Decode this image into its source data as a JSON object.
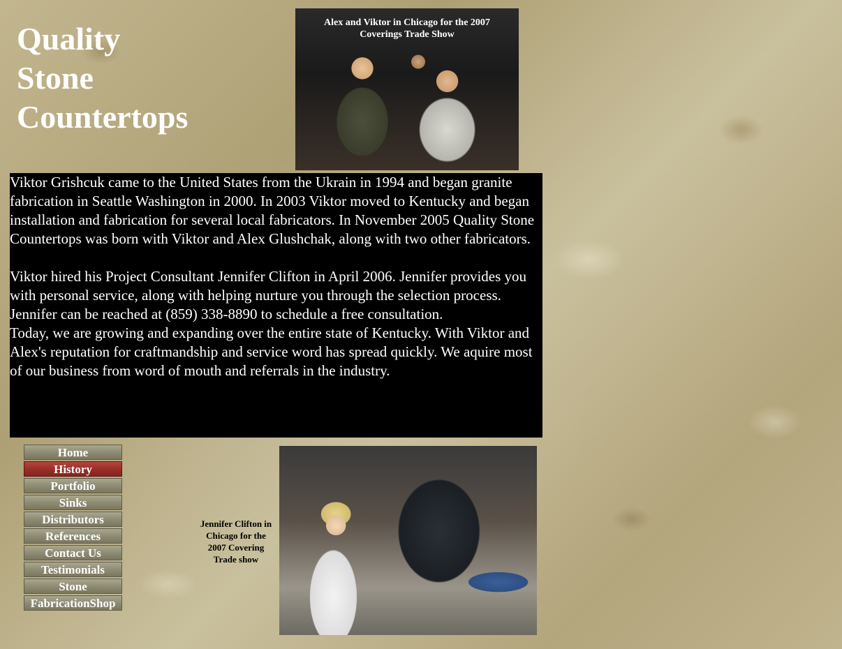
{
  "site": {
    "title_lines": [
      "Quality",
      "Stone",
      "Countertops"
    ]
  },
  "photo_top": {
    "caption_line1": "Alex and Viktor in Chicago for the 2007",
    "caption_line2": "Coverings Trade Show"
  },
  "history": {
    "paragraph1": "Viktor Grishcuk came to the United States from the Ukrain in 1994 and began granite fabrication in Seattle Washington in 2000.  In 2003 Viktor moved to Kentucky and began installation and fabrication for several local fabricators.  In November 2005 Quality Stone Countertops was born with Viktor and Alex Glushchak, along with two other fabricators.",
    "paragraph2": "Viktor hired his Project Consultant Jennifer Clifton in April 2006.  Jennifer provides you with personal service, along with helping nurture you through the selection process.   Jennifer can be reached at (859) 338-8890 to schedule a free consultation.",
    "paragraph3": "Today, we are growing and expanding over the entire state of Kentucky.  With Viktor and Alex's reputation for craftmandship and service word has spread quickly.  We aquire most of our business from word of mouth and referrals in the industry."
  },
  "nav": {
    "items": [
      {
        "label": "Home",
        "active": false
      },
      {
        "label": "History",
        "active": true
      },
      {
        "label": "Portfolio",
        "active": false
      },
      {
        "label": "Sinks",
        "active": false
      },
      {
        "label": "Distributors",
        "active": false
      },
      {
        "label": "References",
        "active": false
      },
      {
        "label": "Contact Us",
        "active": false
      },
      {
        "label": "Testimonials",
        "active": false
      },
      {
        "label": "Stone",
        "active": false
      },
      {
        "label": "FabricationShop",
        "active": false
      }
    ],
    "active_color": "#9a2f28",
    "default_color": "#8f8c74"
  },
  "photo_bottom": {
    "caption": "Jennifer Clifton in Chicago for the 2007 Covering Trade show"
  }
}
